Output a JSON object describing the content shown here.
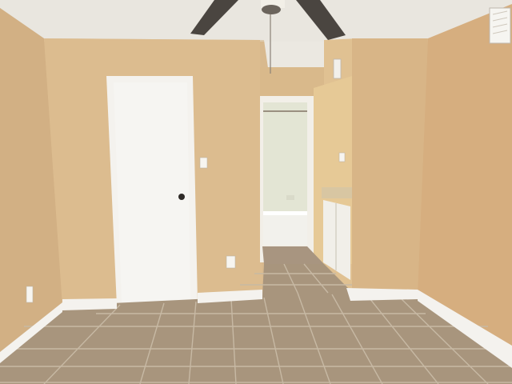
{
  "scene": {
    "type": "photograph",
    "subject": "empty-room-interior",
    "colors": {
      "wall": "#dcbb8e",
      "wall_shadow": "#c9a57a",
      "ceiling": "#e9e6df",
      "floor_tile": "#a8957d",
      "grout": "#c7b9a4",
      "trim": "#f4f2ee",
      "door": "#f6f5f2",
      "fan": "#4a4540",
      "bath_wall": "#e4e6d6",
      "countertop": "#d8c6a2",
      "cabinet": "#f1efe9"
    },
    "icons": [
      "ceiling-fan-icon",
      "air-vent-icon",
      "electrical-outlet-icon",
      "light-switch-icon",
      "door-knob-icon"
    ]
  }
}
